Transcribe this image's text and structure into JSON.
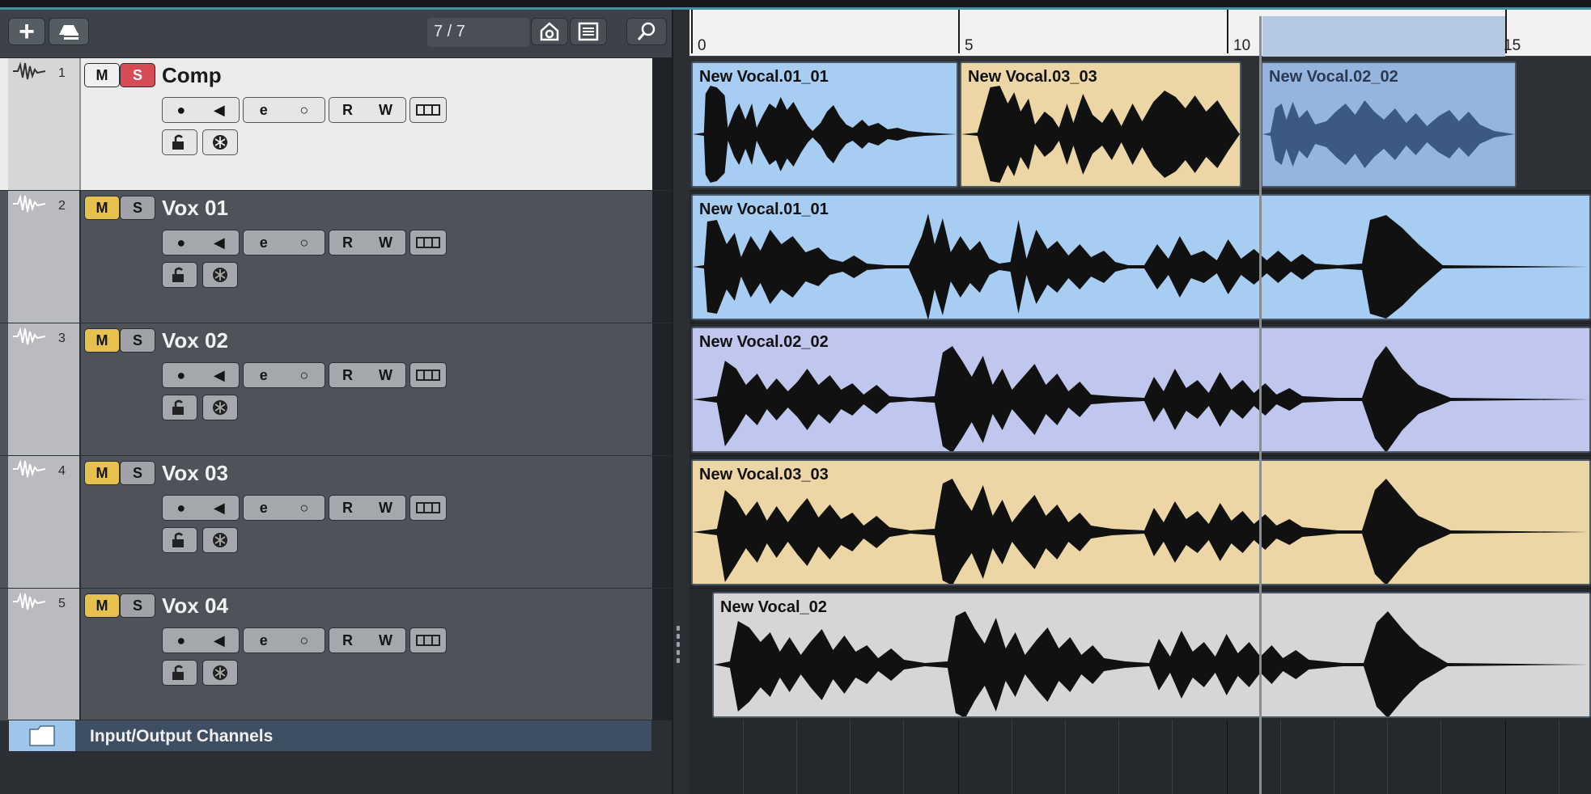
{
  "toolbar": {
    "add_track_label": "+",
    "counter": "7 / 7"
  },
  "tracks": [
    {
      "num": "1",
      "name": "Comp",
      "m": "M",
      "s": "S",
      "rec": "R",
      "write": "W"
    },
    {
      "num": "2",
      "name": "Vox 01",
      "m": "M",
      "s": "S",
      "rec": "R",
      "write": "W"
    },
    {
      "num": "3",
      "name": "Vox 02",
      "m": "M",
      "s": "S",
      "rec": "R",
      "write": "W"
    },
    {
      "num": "4",
      "name": "Vox 03",
      "m": "M",
      "s": "S",
      "rec": "R",
      "write": "W"
    },
    {
      "num": "5",
      "name": "Vox 04",
      "m": "M",
      "s": "S",
      "rec": "R",
      "write": "W"
    }
  ],
  "io_channels": {
    "label": "Input/Output Channels"
  },
  "ruler": {
    "ticks": [
      "0",
      "5",
      "10",
      "15"
    ]
  },
  "events": {
    "comp": [
      "New Vocal.01_01",
      "New Vocal.03_03",
      "New Vocal.02_02"
    ],
    "vox01": "New Vocal.01_01",
    "vox02": "New Vocal.02_02",
    "vox03": "New Vocal.03_03",
    "vox04": "New Vocal_02"
  },
  "colors": {
    "solo_active": "#d74b55",
    "mute_active": "#e6c14e",
    "event_blue": "#a8cdf2",
    "event_lavender": "#bfc7ee",
    "event_tan": "#edd6a5",
    "event_grey": "#d6d6d6"
  }
}
